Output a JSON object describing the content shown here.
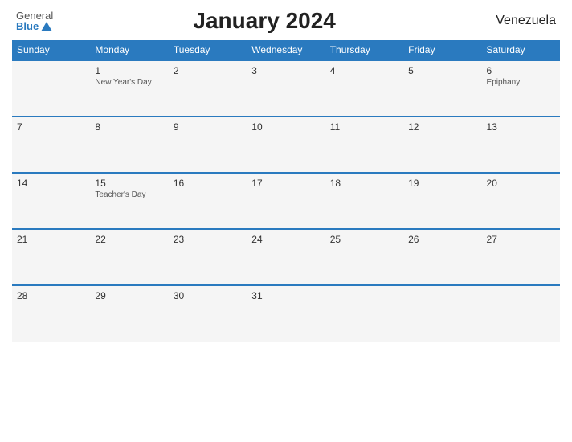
{
  "header": {
    "logo_general": "General",
    "logo_blue": "Blue",
    "title": "January 2024",
    "country": "Venezuela"
  },
  "calendar": {
    "weekdays": [
      "Sunday",
      "Monday",
      "Tuesday",
      "Wednesday",
      "Thursday",
      "Friday",
      "Saturday"
    ],
    "weeks": [
      [
        {
          "day": "",
          "holiday": "",
          "empty": true
        },
        {
          "day": "1",
          "holiday": "New Year's Day",
          "empty": false
        },
        {
          "day": "2",
          "holiday": "",
          "empty": false
        },
        {
          "day": "3",
          "holiday": "",
          "empty": false
        },
        {
          "day": "4",
          "holiday": "",
          "empty": false
        },
        {
          "day": "5",
          "holiday": "",
          "empty": false
        },
        {
          "day": "6",
          "holiday": "Epiphany",
          "empty": false
        }
      ],
      [
        {
          "day": "7",
          "holiday": "",
          "empty": false
        },
        {
          "day": "8",
          "holiday": "",
          "empty": false
        },
        {
          "day": "9",
          "holiday": "",
          "empty": false
        },
        {
          "day": "10",
          "holiday": "",
          "empty": false
        },
        {
          "day": "11",
          "holiday": "",
          "empty": false
        },
        {
          "day": "12",
          "holiday": "",
          "empty": false
        },
        {
          "day": "13",
          "holiday": "",
          "empty": false
        }
      ],
      [
        {
          "day": "14",
          "holiday": "",
          "empty": false
        },
        {
          "day": "15",
          "holiday": "Teacher's Day",
          "empty": false
        },
        {
          "day": "16",
          "holiday": "",
          "empty": false
        },
        {
          "day": "17",
          "holiday": "",
          "empty": false
        },
        {
          "day": "18",
          "holiday": "",
          "empty": false
        },
        {
          "day": "19",
          "holiday": "",
          "empty": false
        },
        {
          "day": "20",
          "holiday": "",
          "empty": false
        }
      ],
      [
        {
          "day": "21",
          "holiday": "",
          "empty": false
        },
        {
          "day": "22",
          "holiday": "",
          "empty": false
        },
        {
          "day": "23",
          "holiday": "",
          "empty": false
        },
        {
          "day": "24",
          "holiday": "",
          "empty": false
        },
        {
          "day": "25",
          "holiday": "",
          "empty": false
        },
        {
          "day": "26",
          "holiday": "",
          "empty": false
        },
        {
          "day": "27",
          "holiday": "",
          "empty": false
        }
      ],
      [
        {
          "day": "28",
          "holiday": "",
          "empty": false
        },
        {
          "day": "29",
          "holiday": "",
          "empty": false
        },
        {
          "day": "30",
          "holiday": "",
          "empty": false
        },
        {
          "day": "31",
          "holiday": "",
          "empty": false
        },
        {
          "day": "",
          "holiday": "",
          "empty": true
        },
        {
          "day": "",
          "holiday": "",
          "empty": true
        },
        {
          "day": "",
          "holiday": "",
          "empty": true
        }
      ]
    ]
  }
}
